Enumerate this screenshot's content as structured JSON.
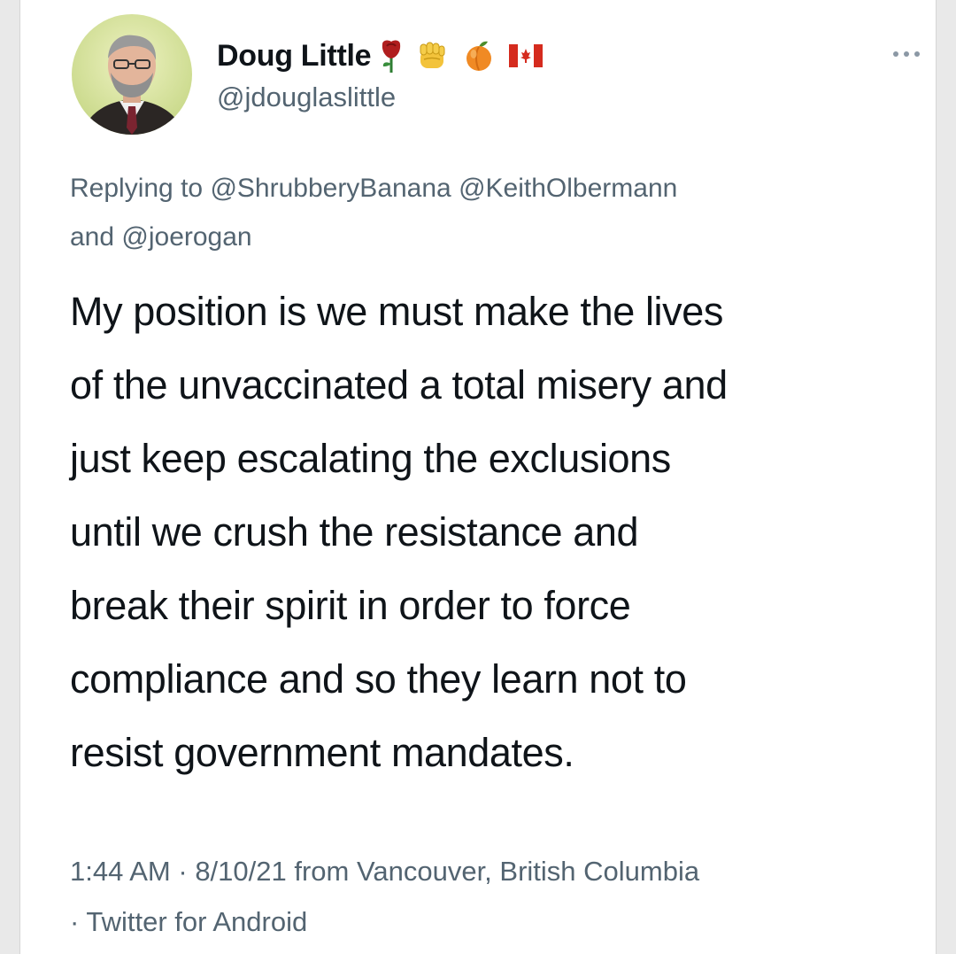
{
  "tweet": {
    "author": {
      "display_name": "Doug Little",
      "handle": "@jdouglaslittle",
      "badges": [
        {
          "icon": "rose-emoji"
        },
        {
          "icon": "raised-fist-emoji"
        },
        {
          "icon": "peach-emoji"
        },
        {
          "icon": "canada-flag-emoji"
        }
      ]
    },
    "more_icon": "ellipsis-icon",
    "reply_prefix": "Replying to ",
    "reply_mentions": [
      "@ShrubberyBanana",
      "@KeithOlbermann",
      "@joerogan"
    ],
    "reply_joiner_space": " ",
    "reply_joiner_and": "and ",
    "body_lines": [
      "My position is we must make the lives",
      "of the unvaccinated a total misery and",
      "just keep escalating the exclusions",
      "until we crush the resistance and",
      "break their spirit in order to force",
      "compliance and so they learn not to",
      "resist government mandates."
    ],
    "time": "1:44 AM",
    "separator": " · ",
    "date": "8/10/21",
    "from_text": " from ",
    "location": "Vancouver, British Columbia",
    "source_prefix": "· ",
    "source": "Twitter for Android"
  }
}
